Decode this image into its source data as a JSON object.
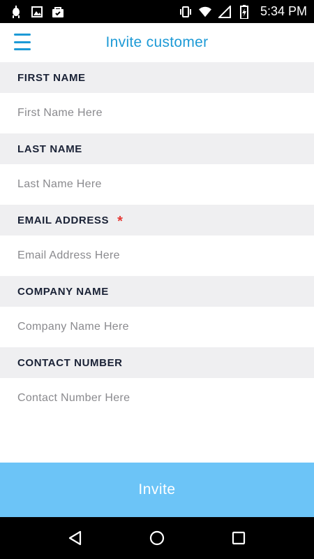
{
  "status_bar": {
    "time": "5:34 PM",
    "left_icons": [
      "android-debug-icon",
      "image-icon",
      "bag-icon"
    ],
    "right_icons": [
      "vibrate-icon",
      "wifi-icon",
      "signal-icon",
      "battery-charging-icon"
    ]
  },
  "header": {
    "title": "Invite customer",
    "menu_icon": "hamburger-menu-icon",
    "accent_color": "#1d9ad6"
  },
  "form": {
    "fields": [
      {
        "label": "FIRST NAME",
        "placeholder": "First Name Here",
        "value": "",
        "required": false
      },
      {
        "label": "LAST NAME",
        "placeholder": "Last Name Here",
        "value": "",
        "required": false
      },
      {
        "label": "EMAIL ADDRESS",
        "placeholder": "Email Address Here",
        "value": "",
        "required": true,
        "required_mark": "*"
      },
      {
        "label": "COMPANY NAME",
        "placeholder": "Company Name Here",
        "value": "",
        "required": false
      },
      {
        "label": "CONTACT NUMBER",
        "placeholder": "Contact Number Here",
        "value": "",
        "required": false
      }
    ]
  },
  "actions": {
    "invite_label": "Invite",
    "invite_color": "#6cc4f7"
  },
  "nav_bar": {
    "icons": [
      "back-triangle-icon",
      "home-circle-icon",
      "recents-square-icon"
    ]
  }
}
